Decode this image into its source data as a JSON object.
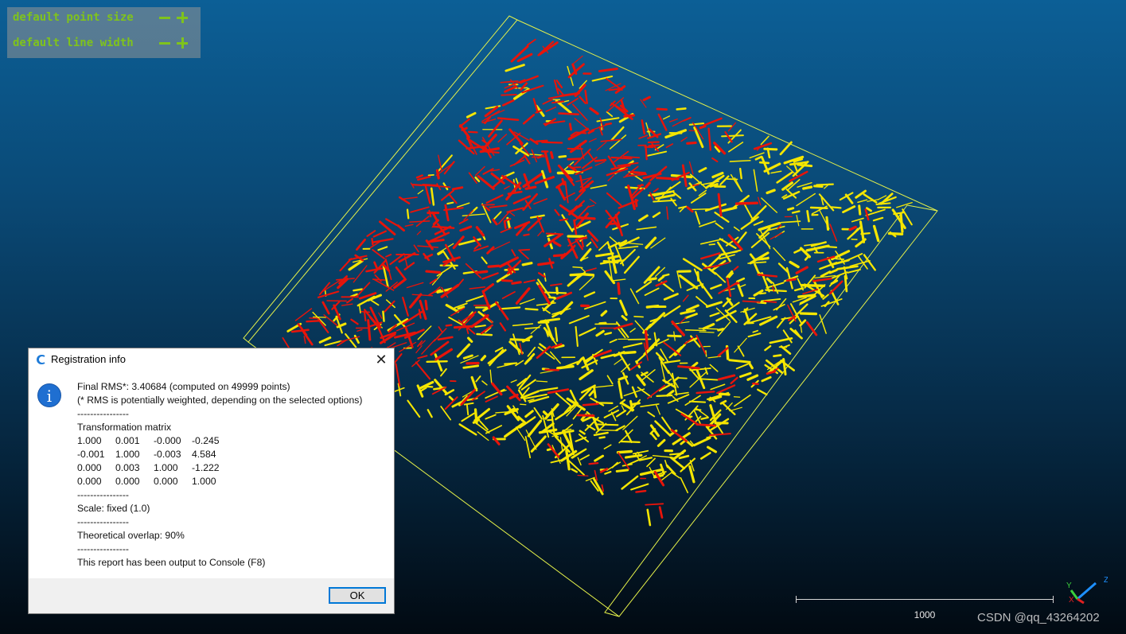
{
  "overlay": {
    "point_size_label": "default point size",
    "line_width_label": "default line width"
  },
  "scale": {
    "label": "1000"
  },
  "watermark": "CSDN @qq_43264202",
  "axes": {
    "x": "X",
    "y": "Y",
    "z": "Z"
  },
  "dialog": {
    "title": "Registration info",
    "close_glyph": "✕",
    "info_glyph": "i",
    "lines": {
      "rms": "Final RMS*: 3.40684 (computed on 49999 points)",
      "rms_note": "(* RMS is potentially weighted, depending on the selected options)",
      "sep1": "----------------",
      "matrix_title": "Transformation matrix",
      "sep2": "----------------",
      "scale": "Scale: fixed (1.0)",
      "sep3": "----------------",
      "overlap": "Theoretical overlap: 90%",
      "sep4": "----------------",
      "console": "This report has been output to Console (F8)"
    },
    "matrix": [
      [
        "1.000",
        "0.001",
        "-0.000",
        "-0.245"
      ],
      [
        "-0.001",
        "1.000",
        "-0.003",
        "4.584"
      ],
      [
        "0.000",
        "0.003",
        "1.000",
        "-1.222"
      ],
      [
        "0.000",
        "0.000",
        "0.000",
        "1.000"
      ]
    ],
    "ok_label": "OK"
  },
  "colors": {
    "overlay_text": "#7fc31c",
    "box_outline": "#e6f24a",
    "cloud_reference": "#f5e600",
    "cloud_aligned": "#e8140a"
  }
}
